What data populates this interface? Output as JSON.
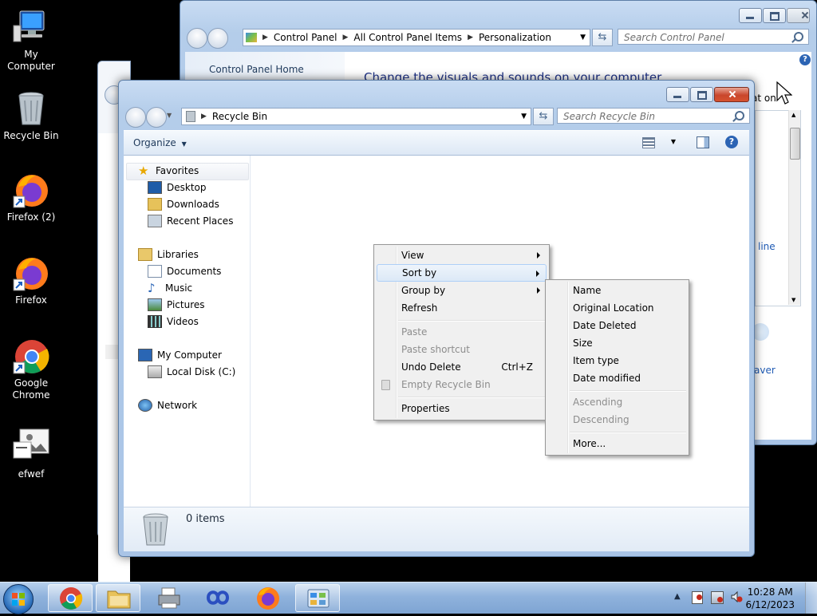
{
  "desktop": {
    "icons": [
      {
        "label": "My Computer"
      },
      {
        "label": "Recycle Bin"
      },
      {
        "label": "Firefox (2)"
      },
      {
        "label": "Firefox"
      },
      {
        "label": "Google Chrome"
      },
      {
        "label": "efwef"
      }
    ]
  },
  "control_panel": {
    "breadcrumb": [
      "Control Panel",
      "All Control Panel Items",
      "Personalization"
    ],
    "search_placeholder": "Search Control Panel",
    "home_link": "Control Panel Home",
    "heading": "Change the visuals and sounds on your computer",
    "partial_text_1": "at on",
    "partial_text_2": "line",
    "partial_text_3": "aver"
  },
  "recycle_bin": {
    "breadcrumb": [
      "Recycle Bin"
    ],
    "search_placeholder": "Search Recycle Bin",
    "organize_label": "Organize",
    "nav": {
      "favorites": "Favorites",
      "desktop": "Desktop",
      "downloads": "Downloads",
      "recent": "Recent Places",
      "libraries": "Libraries",
      "documents": "Documents",
      "music": "Music",
      "pictures": "Pictures",
      "videos": "Videos",
      "my_computer": "My Computer",
      "local_disk": "Local Disk (C:)",
      "network": "Network"
    },
    "status_text": "0 items"
  },
  "context_menu": {
    "view": "View",
    "sort_by": "Sort by",
    "group_by": "Group by",
    "refresh": "Refresh",
    "paste": "Paste",
    "paste_shortcut": "Paste shortcut",
    "undo_delete": "Undo Delete",
    "undo_shortcut": "Ctrl+Z",
    "empty_recycle_bin": "Empty Recycle Bin",
    "properties": "Properties"
  },
  "sort_menu": {
    "name": "Name",
    "original_location": "Original Location",
    "date_deleted": "Date Deleted",
    "size": "Size",
    "item_type": "Item type",
    "date_modified": "Date modified",
    "ascending": "Ascending",
    "descending": "Descending",
    "more": "More..."
  },
  "taskbar": {
    "time": "10:28 AM",
    "date": "6/12/2023"
  },
  "colors": {
    "accent": "#1e5aa8",
    "link": "#1e5ab4",
    "highlight_border": "#aecff7"
  }
}
